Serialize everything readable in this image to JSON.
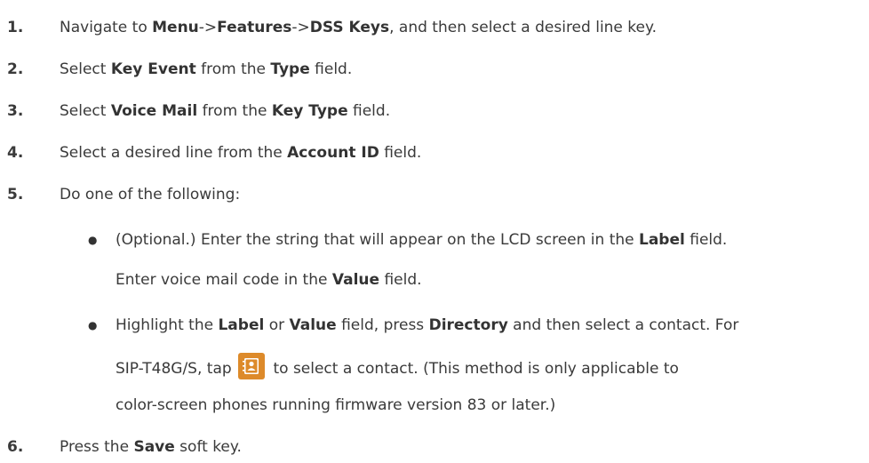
{
  "steps": [
    {
      "num": "1.",
      "parts": [
        "Navigate to ",
        "Menu",
        "->",
        "Features",
        "->",
        "DSS Keys",
        ", and then select a desired line key."
      ]
    },
    {
      "num": "2.",
      "parts": [
        "Select ",
        "Key Event",
        " from the ",
        "Type",
        " field."
      ]
    },
    {
      "num": "3.",
      "parts": [
        "Select ",
        "Voice Mail",
        " from the ",
        "Key Type",
        " field."
      ]
    },
    {
      "num": "4.",
      "parts": [
        "Select a desired line from the ",
        "Account ID",
        " field."
      ]
    },
    {
      "num": "5.",
      "parts": [
        "Do one of the following:"
      ]
    },
    {
      "num": "6.",
      "parts": [
        "Press the ",
        "Save",
        " soft key."
      ]
    }
  ],
  "bullets": [
    {
      "line1": [
        "(Optional.) Enter the string that will appear on the LCD screen in the ",
        "Label",
        " field."
      ],
      "line2": [
        "Enter voice mail code in the ",
        "Value",
        " field."
      ]
    },
    {
      "line1": [
        "Highlight the ",
        "Label",
        " or ",
        "Value",
        " field, press ",
        "Directory",
        " and then select a contact. For"
      ],
      "line2_before_icon": "SIP-T48G/S, tap",
      "line2_after_icon": "to select a contact. (This method is only applicable to",
      "line3": "color-screen phones running firmware version 83 or later.)"
    }
  ],
  "bullet_char": "●",
  "icon": {
    "name": "directory-contact-icon",
    "color": "#dd8a2a"
  }
}
